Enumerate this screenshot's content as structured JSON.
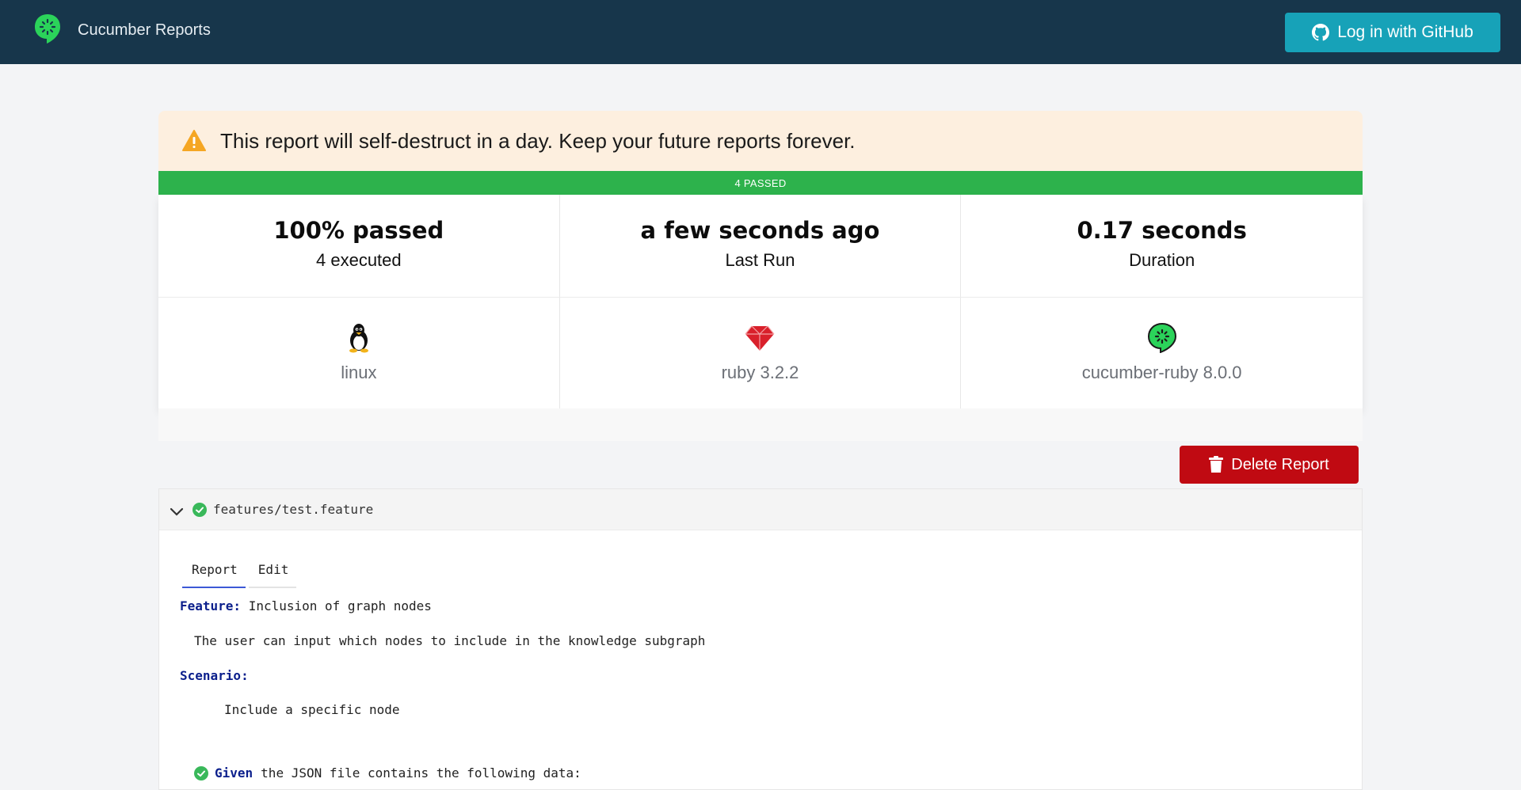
{
  "header": {
    "brand_name": "Cucumber Reports",
    "logo_icon": "cucumber-logo-icon",
    "login_button": "Log in with GitHub",
    "login_icon": "github-icon",
    "bg_color": "#17364b",
    "button_color": "#17a2b8"
  },
  "warning": {
    "icon": "warning-triangle-icon",
    "text": "This report will self-destruct in a day. Keep your future reports forever."
  },
  "status_bar": {
    "text": "4 PASSED",
    "color": "#2db24c"
  },
  "stats": [
    {
      "value": "100% passed",
      "label": "4 executed"
    },
    {
      "value": "a few seconds ago",
      "label": "Last Run"
    },
    {
      "value": "0.17 seconds",
      "label": "Duration"
    }
  ],
  "environment": [
    {
      "icon": "linux-penguin-icon",
      "label": "linux"
    },
    {
      "icon": "ruby-gem-icon",
      "label": "ruby 3.2.2"
    },
    {
      "icon": "cucumber-logo-icon",
      "label": "cucumber-ruby 8.0.0"
    }
  ],
  "delete_button": {
    "label": "Delete Report",
    "icon": "trash-icon",
    "color": "#c00a12"
  },
  "feature_file": {
    "path": "features/test.feature",
    "status": "passed",
    "tabs": [
      "Report",
      "Edit"
    ],
    "active_tab": "Report",
    "feature_keyword": "Feature:",
    "feature_name": "Inclusion of graph nodes",
    "description": "The user can input which nodes to include in the knowledge subgraph",
    "scenario_keyword": "Scenario:",
    "scenario_name": "Include a specific node",
    "steps": [
      {
        "keyword": "Given",
        "text": "the JSON file contains the following data:",
        "status": "passed"
      }
    ]
  }
}
